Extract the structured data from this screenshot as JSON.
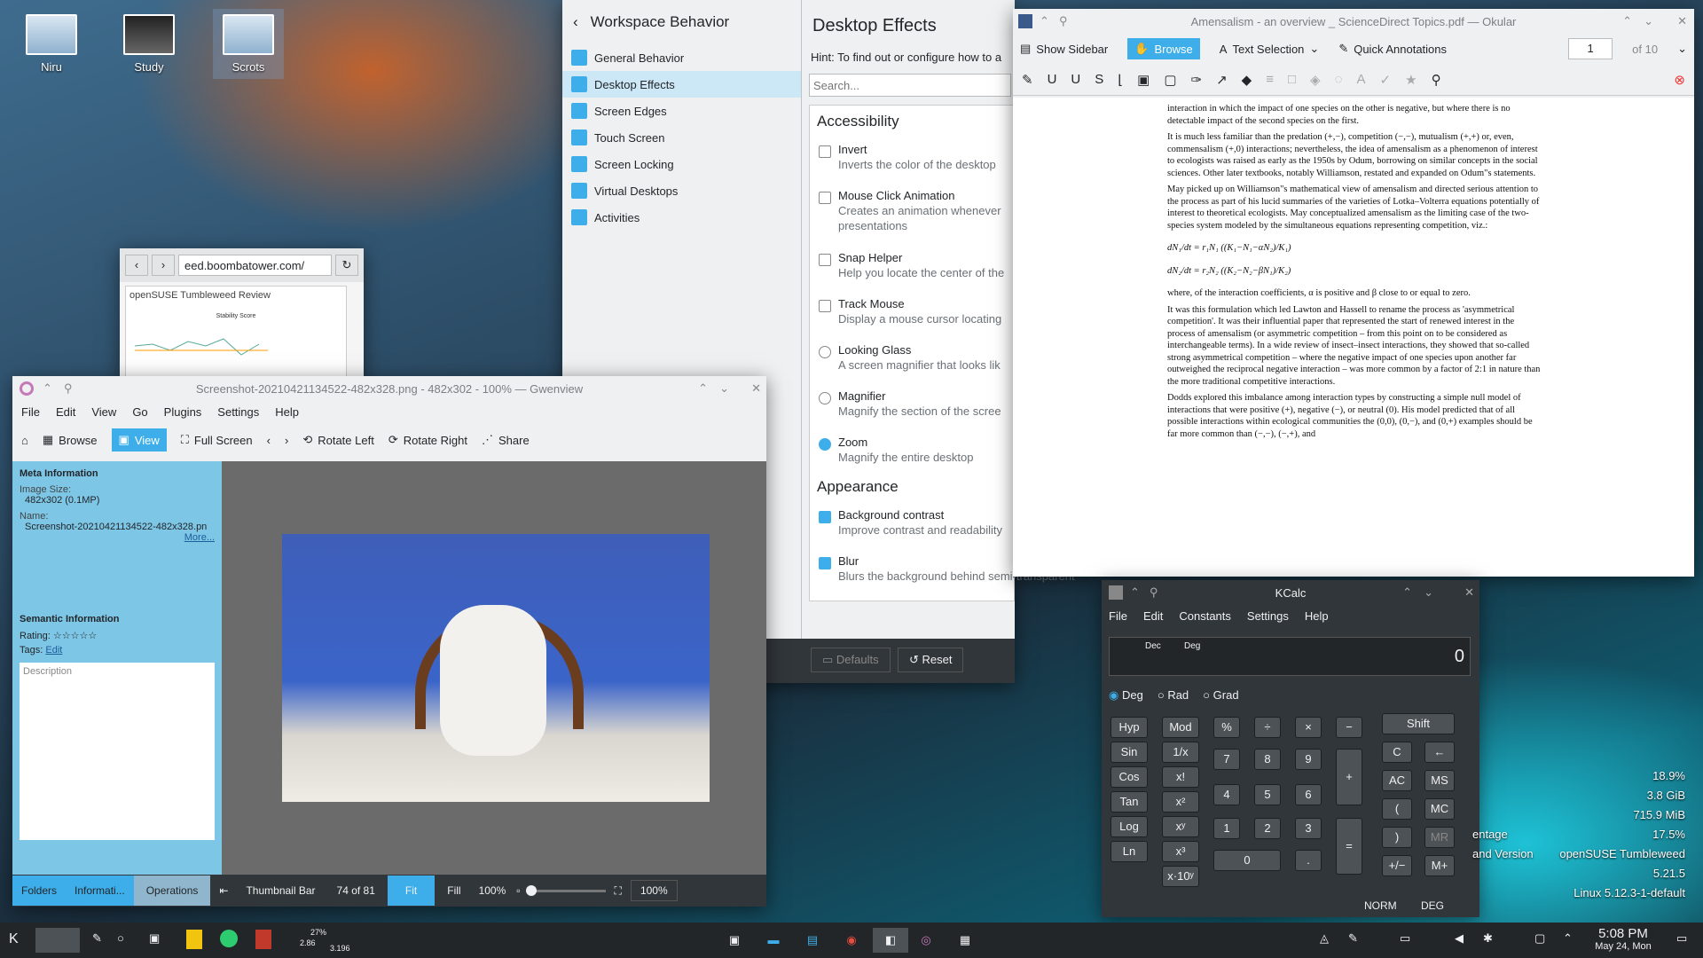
{
  "desktop": {
    "icons": [
      "Niru",
      "Study",
      "Scrots"
    ]
  },
  "browser": {
    "url": "eed.boombatower.com/",
    "tab": "openSUSE Tumbleweed Review",
    "chart_title": "Stability Score"
  },
  "settings": {
    "back_title": "Workspace Behavior",
    "title": "Desktop Effects",
    "sidebar": [
      "General Behavior",
      "Desktop Effects",
      "Screen Edges",
      "Touch Screen",
      "Screen Locking",
      "Virtual Desktops",
      "Activities"
    ],
    "hint": "Hint: To find out or configure how to a",
    "search_placeholder": "Search...",
    "section1": "Accessibility",
    "effects": [
      {
        "name": "Invert",
        "desc": "Inverts the color of the desktop"
      },
      {
        "name": "Mouse Click Animation",
        "desc": "Creates an animation whenever",
        "desc2": "presentations"
      },
      {
        "name": "Snap Helper",
        "desc": "Help you locate the center of the"
      },
      {
        "name": "Track Mouse",
        "desc": "Display a mouse cursor locating"
      },
      {
        "name": "Looking Glass",
        "desc": "A screen magnifier that looks lik"
      },
      {
        "name": "Magnifier",
        "desc": "Magnify the section of the scree"
      },
      {
        "name": "Zoom",
        "desc": "Magnify the entire desktop"
      }
    ],
    "section2": "Appearance",
    "appearance": [
      {
        "name": "Background contrast",
        "desc": "Improve contrast and readability"
      },
      {
        "name": "Blur",
        "desc": "Blurs the background behind semi-transparent"
      }
    ],
    "defaults": "Defaults",
    "reset": "Reset"
  },
  "okular": {
    "title": "Amensalism - an overview _ ScienceDirect Topics.pdf — Okular",
    "show_sidebar": "Show Sidebar",
    "browse": "Browse",
    "text_selection": "Text Selection",
    "quick_annotations": "Quick Annotations",
    "page": "1",
    "of": "of",
    "pages": "10",
    "p0": "interaction in which the impact of one species on the other is negative, but where there is no detectable impact of the second species on the first.",
    "p1": "It is much less familiar than the predation (+,−), competition (−,−), mutualism (+,+) or, even, commensalism (+,0) interactions; nevertheless, the idea of amensalism as a phenomenon of interest to ecologists was raised as early as the 1950s by Odum, borrowing on similar concepts in the social sciences. Other later textbooks, notably Williamson, restated and expanded on Odum\"s statements.",
    "p2": "May picked up on Williamson\"s mathematical view of amensalism and directed serious attention to the process as part of his lucid summaries of the varieties of Lotka–Volterra equations potentially of interest to theoretical ecologists. May conceptualized amensalism as the limiting case of the two-species system modeled by the simultaneous equations representing competition, viz.:",
    "eq1": "dN₁/dt = r₁N₁ ((K₁−N₁−αN₂)/K₁)",
    "eq2": "dN₂/dt = r₂N₂ ((K₂−N₂−βN₁)/K₂)",
    "p3": "where, of the interaction coefficients, α is positive and β close to or equal to zero.",
    "p4": "It was this formulation which led Lawton and Hassell to rename the process as 'asymmetrical competition'. It was their influential paper that represented the start of renewed interest in the process of amensalism (or asymmetric competition – from this point on to be considered as interchangeable terms). In a wide review of insect–insect interactions, they showed that so-called strong asymmetrical competition – where the negative impact of one species upon another far outweighed the reciprocal negative interaction – was more common by a factor of 2:1 in nature than the more traditional competitive interactions.",
    "p5": "Dodds explored this imbalance among interaction types by constructing a simple null model of interactions that were positive (+), negative (−), or neutral (0). His model predicted that of all possible interactions within ecological communities the (0,0), (0,−), and (0,+) examples should be far more common than (−,−), (−,+), and"
  },
  "gwenview": {
    "title": "Screenshot-20210421134522-482x328.png - 482x302 - 100% — Gwenview",
    "menu": [
      "File",
      "Edit",
      "View",
      "Go",
      "Plugins",
      "Settings",
      "Help"
    ],
    "toolbar": [
      "Browse",
      "View",
      "Full Screen",
      "Rotate Left",
      "Rotate Right",
      "Share"
    ],
    "meta_heading": "Meta Information",
    "image_size_label": "Image Size:",
    "image_size": "482x302 (0.1MP)",
    "name_label": "Name:",
    "name": "Screenshot-20210421134522-482x328.pn",
    "more": "More...",
    "semantic_heading": "Semantic Information",
    "rating_label": "Rating:",
    "rating": 0,
    "tags_label": "Tags:",
    "tags_edit": "Edit",
    "description_placeholder": "Description",
    "tabs": [
      "Folders",
      "Informati...",
      "Operations"
    ],
    "thumbnail_bar": "Thumbnail Bar",
    "position": "74 of 81",
    "fit": "Fit",
    "fill": "Fill",
    "zoom": "100%",
    "zoom_field": "100%"
  },
  "kcalc": {
    "title": "KCalc",
    "menu": [
      "File",
      "Edit",
      "Constants",
      "Settings",
      "Help"
    ],
    "dec": "Dec",
    "deg": "Deg",
    "display": "0",
    "modes": [
      "Deg",
      "Rad",
      "Grad"
    ],
    "left": [
      "Hyp",
      "Mod",
      "Sin",
      "1/x",
      "Cos",
      "x!",
      "Tan",
      "x²",
      "Log",
      "xʸ",
      "Ln",
      "x³",
      "",
      "x·10ʸ"
    ],
    "nums": [
      "%",
      "÷",
      "×",
      "−",
      "7",
      "8",
      "9",
      "+",
      "4",
      "5",
      "6",
      "1",
      "2",
      "3",
      "=",
      "0",
      "."
    ],
    "right": [
      "Shift",
      "C",
      "←",
      "AC",
      "MS",
      "(",
      "MC",
      ")",
      "MR",
      "+/−",
      "M+"
    ],
    "status_norm": "NORM",
    "status_deg": "DEG"
  },
  "sysmon": {
    "cpu": "18.9%",
    "mem": "3.8 GiB",
    "swap": "715.9 MiB",
    "pct_label": "entage",
    "pct": "17.5%",
    "distro_label": "and Version",
    "distro": "openSUSE Tumbleweed",
    "plasma": "5.21.5",
    "kernel": "Linux 5.12.3-1-default"
  },
  "taskbar": {
    "time": "5:08 PM",
    "date": "May 24, Mon",
    "net_up": "27%",
    "net_a": "2.86",
    "net_b": "3.196"
  }
}
